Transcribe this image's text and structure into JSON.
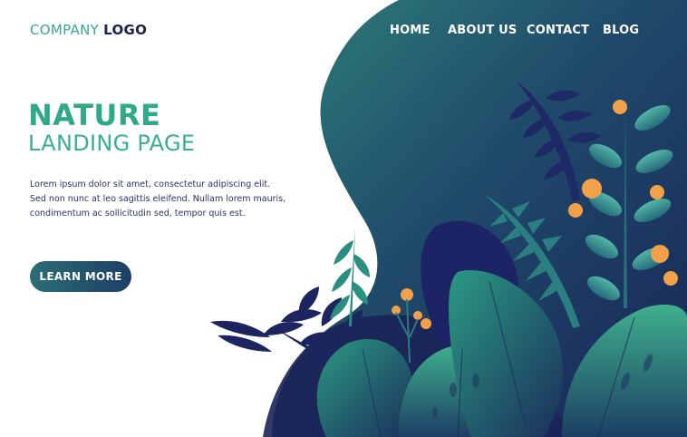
{
  "logo": {
    "company": "COMPANY",
    "word": "LOGO"
  },
  "nav": {
    "items": [
      "HOME",
      "ABOUT US",
      "CONTACT",
      "BLOG"
    ]
  },
  "hero": {
    "title": "NATURE",
    "subtitle": "LANDING PAGE",
    "body_lines": [
      "Lorem ipsum dolor sit amet, consectetur adipiscing elit.",
      "Sed non nunc at leo sagittis eleifend. Nullam lorem mauris,",
      "condimentum ac sollicitudin sed, tempor quis est."
    ],
    "cta_label": "LEARN MORE"
  },
  "colors": {
    "accent": "#2fa98a",
    "navy": "#1a1f4b",
    "blob_dark": "#1b2d5c",
    "blob_teal": "#2e7d7a",
    "berry": "#f2a04a"
  }
}
